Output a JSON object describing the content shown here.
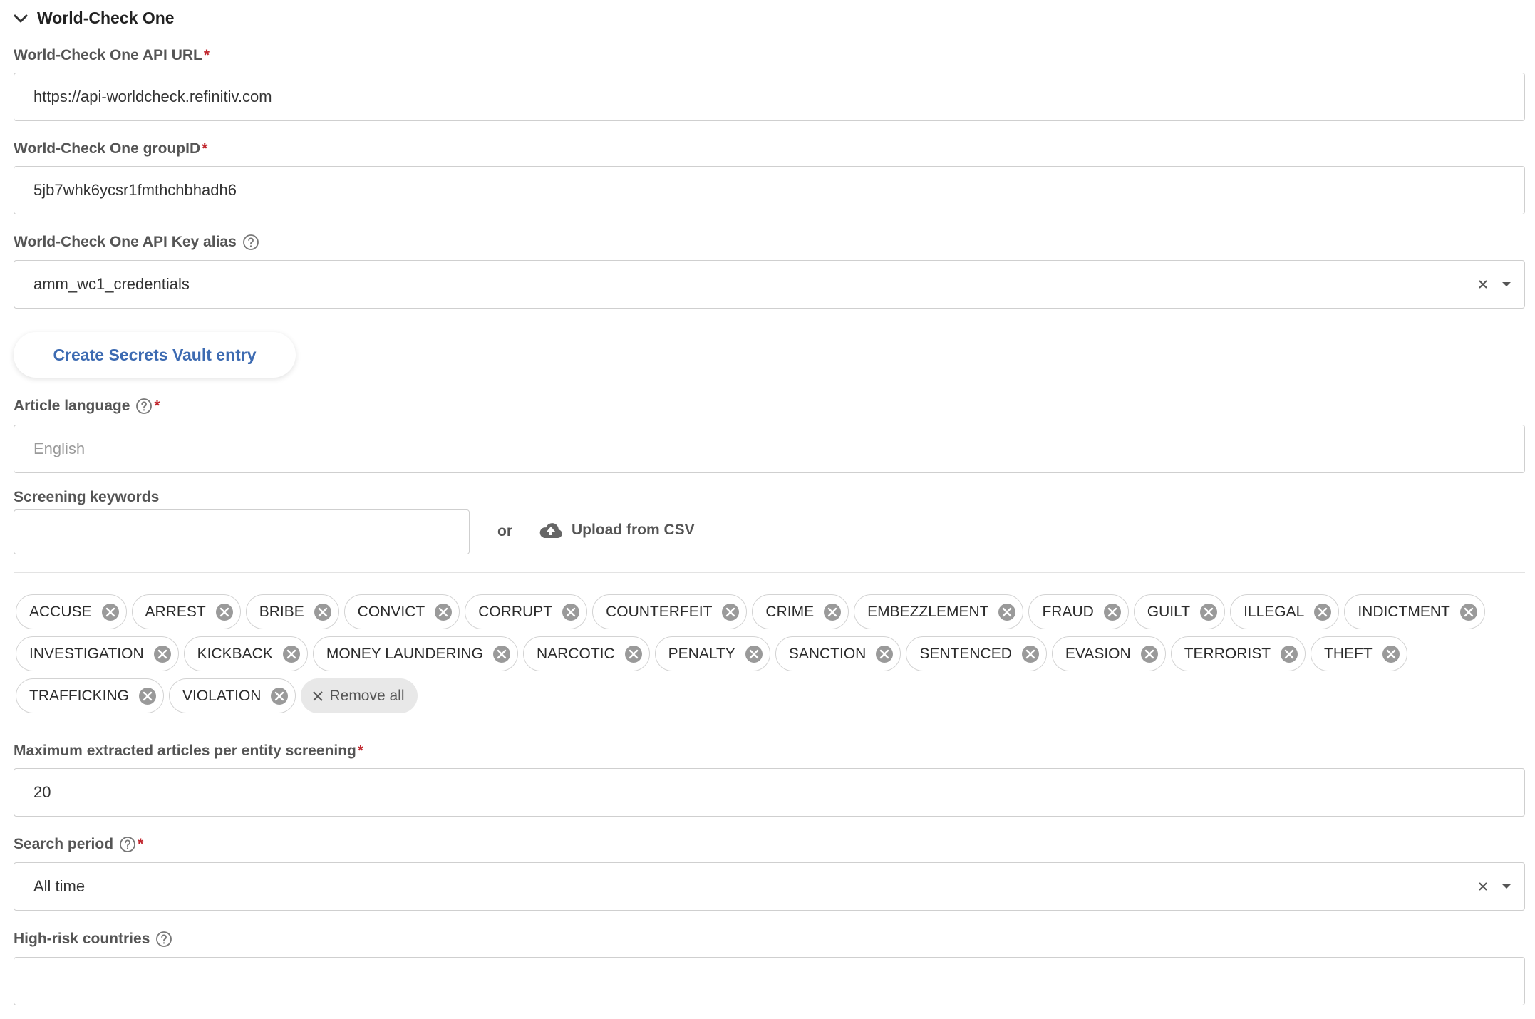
{
  "section": {
    "title": "World-Check One"
  },
  "api_url": {
    "label": "World-Check One API URL",
    "required": "*",
    "value": "https://api-worldcheck.refinitiv.com"
  },
  "group_id": {
    "label": "World-Check One groupID",
    "required": "*",
    "value": "5jb7whk6ycsr1fmthchbhadh6"
  },
  "api_key_alias": {
    "label": "World-Check One API Key alias",
    "value": "amm_wc1_credentials"
  },
  "vault_button": {
    "label": "Create Secrets Vault entry"
  },
  "article_language": {
    "label": "Article language",
    "required": "*",
    "placeholder": "English"
  },
  "screening_keywords": {
    "label": "Screening keywords",
    "input_value": "",
    "or_text": "or",
    "upload_label": "Upload from CSV",
    "chips": [
      "ACCUSE",
      "ARREST",
      "BRIBE",
      "CONVICT",
      "CORRUPT",
      "COUNTERFEIT",
      "CRIME",
      "EMBEZZLEMENT",
      "FRAUD",
      "GUILT",
      "ILLEGAL",
      "INDICTMENT",
      "INVESTIGATION",
      "KICKBACK",
      "MONEY LAUNDERING",
      "NARCOTIC",
      "PENALTY",
      "SANCTION",
      "SENTENCED",
      "EVASION",
      "TERRORIST",
      "THEFT",
      "TRAFFICKING",
      "VIOLATION"
    ],
    "remove_all_label": "Remove all"
  },
  "max_articles": {
    "label": "Maximum extracted articles per entity screening",
    "required": "*",
    "value": "20"
  },
  "search_period": {
    "label": "Search period",
    "required": "*",
    "value": "All time"
  },
  "high_risk_countries": {
    "label": "High-risk countries",
    "value": ""
  },
  "colors": {
    "accent": "#3d6bb2",
    "required": "#c0262d",
    "border": "#cfcfcf",
    "chip_border": "#d3d3d3",
    "chip_remove_icon": "#9a9a9a"
  },
  "icons": {
    "section_toggle": "chevron-down-icon",
    "help": "help-circle-icon",
    "clear": "clear-icon",
    "dropdown": "caret-down-icon",
    "upload": "cloud-upload-icon",
    "chip_remove": "remove-circle-icon",
    "remove_all": "close-icon"
  }
}
